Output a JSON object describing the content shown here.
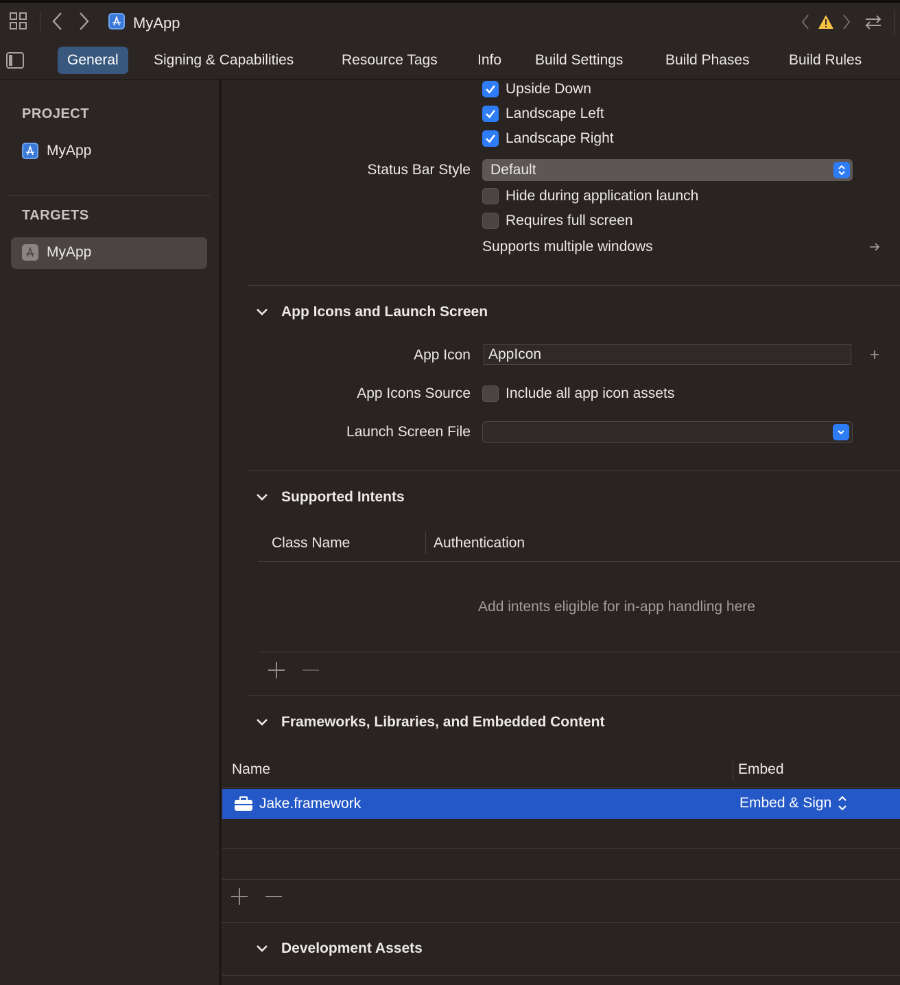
{
  "window": {
    "title": "MyApp"
  },
  "tabs": [
    {
      "label": "General",
      "active": true
    },
    {
      "label": "Signing & Capabilities"
    },
    {
      "label": "Resource Tags"
    },
    {
      "label": "Info"
    },
    {
      "label": "Build Settings"
    },
    {
      "label": "Build Phases"
    },
    {
      "label": "Build Rules"
    }
  ],
  "sidebar": {
    "project_header": "PROJECT",
    "project_item": "MyApp",
    "targets_header": "TARGETS",
    "target_item": "MyApp"
  },
  "orientation": {
    "upside_down": {
      "label": "Upside Down",
      "checked": true
    },
    "landscape_left": {
      "label": "Landscape Left",
      "checked": true
    },
    "landscape_right": {
      "label": "Landscape Right",
      "checked": true
    }
  },
  "status_bar": {
    "label": "Status Bar Style",
    "value": "Default",
    "hide_label": "Hide during application launch",
    "full_screen_label": "Requires full screen",
    "multiple_windows_label": "Supports multiple windows"
  },
  "app_icons": {
    "section_title": "App Icons and Launch Screen",
    "app_icon_label": "App Icon",
    "app_icon_value": "AppIcon",
    "source_label": "App Icons Source",
    "source_checkbox_label": "Include all app icon assets",
    "launch_label": "Launch Screen File",
    "launch_value": ""
  },
  "intents": {
    "section_title": "Supported Intents",
    "col_class": "Class Name",
    "col_auth": "Authentication",
    "placeholder": "Add intents eligible for in-app handling here"
  },
  "frameworks": {
    "section_title": "Frameworks, Libraries, and Embedded Content",
    "col_name": "Name",
    "col_embed": "Embed",
    "rows": [
      {
        "name": "Jake.framework",
        "embed": "Embed & Sign"
      }
    ]
  },
  "dev_assets": {
    "section_title": "Development Assets"
  },
  "colors": {
    "accent": "#2e7cf6",
    "selection": "#2458c7",
    "background": "#292321"
  }
}
